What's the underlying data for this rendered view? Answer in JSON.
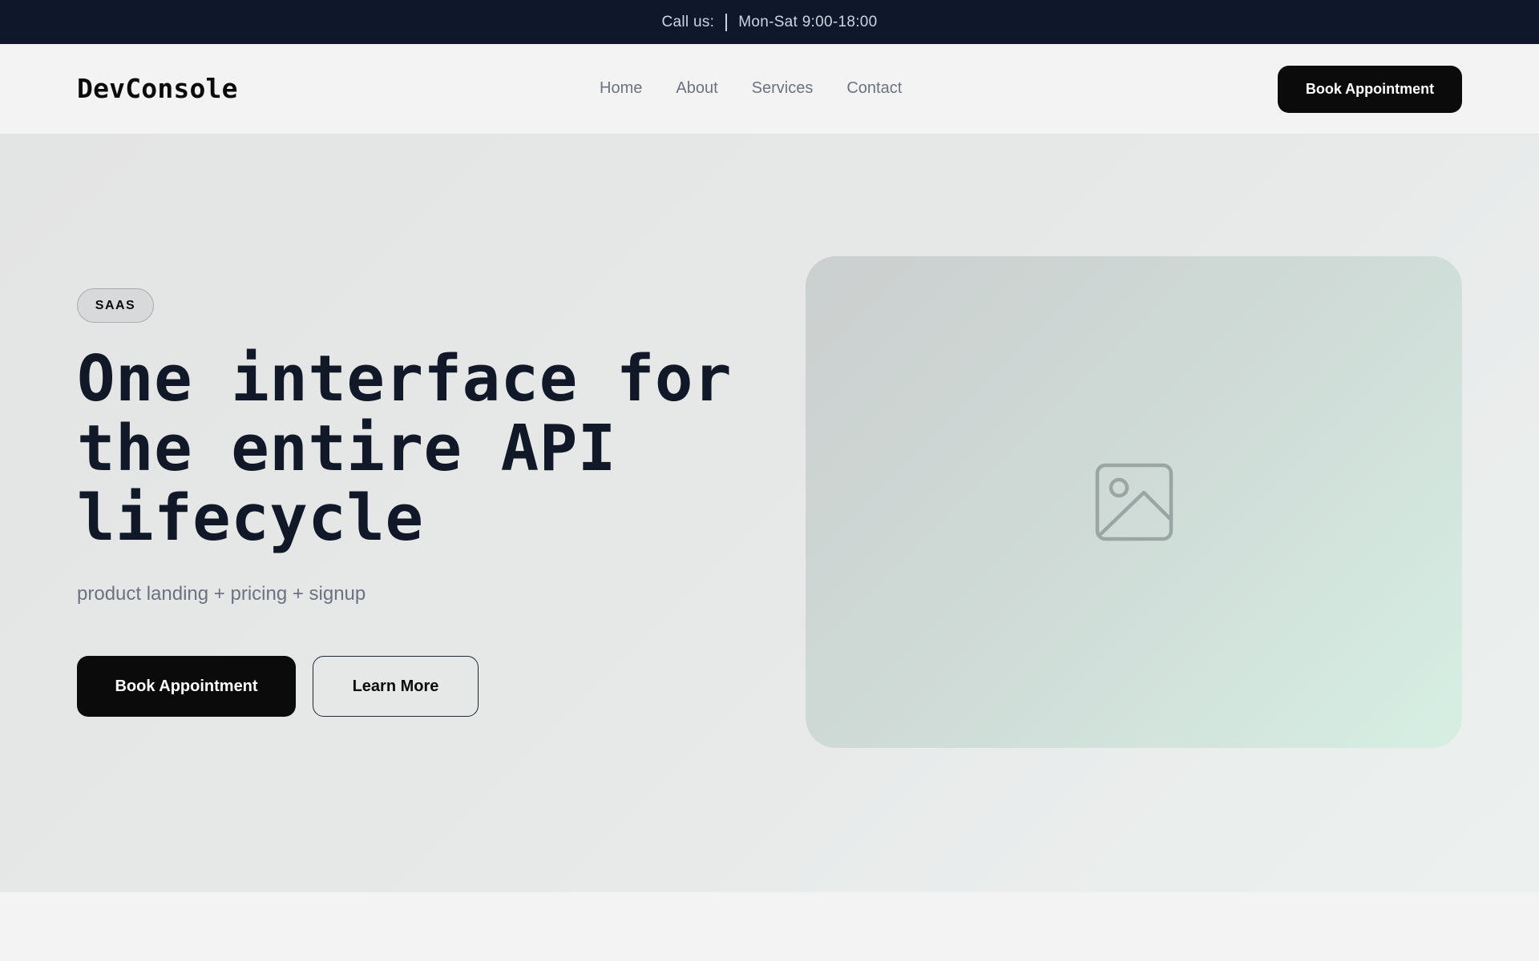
{
  "topbar": {
    "call_label": "Call us:",
    "hours": "Mon-Sat 9:00-18:00"
  },
  "header": {
    "logo": "DevConsole",
    "nav": [
      {
        "label": "Home"
      },
      {
        "label": "About"
      },
      {
        "label": "Services"
      },
      {
        "label": "Contact"
      }
    ],
    "cta_label": "Book Appointment"
  },
  "hero": {
    "badge": "SAAS",
    "headline": "One interface for the entire API lifecycle",
    "subtitle": "product landing + pricing + signup",
    "primary_button": "Book Appointment",
    "secondary_button": "Learn More",
    "image_icon": "image-placeholder-icon"
  },
  "colors": {
    "topbar_bg": "#0f172a",
    "primary": "#0b0b0b",
    "text_muted": "#6b7280",
    "heading": "#111827"
  }
}
